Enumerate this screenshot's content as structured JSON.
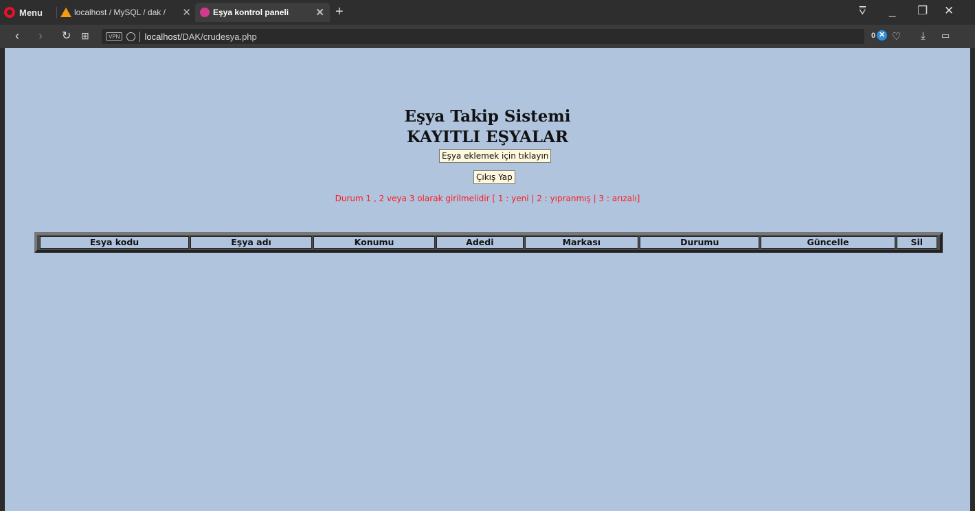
{
  "browser": {
    "menu_label": "Menu",
    "tabs": [
      {
        "title": "localhost / MySQL / dak / ",
        "active": false
      },
      {
        "title": "Eşya kontrol paneli",
        "active": true
      }
    ],
    "new_tab": "+",
    "url_host": "localhost",
    "url_path": "/DAK/crudesya.php",
    "vpn_label": "VPN",
    "adblock_count": "0",
    "icons": [
      "opera-logo",
      "phpmyadmin-favicon",
      "tab-favicon",
      "back-icon",
      "forward-icon",
      "reload-icon",
      "speed-dial-icon",
      "globe-icon",
      "heart-icon",
      "download-icon",
      "battery-icon"
    ]
  },
  "page": {
    "heading": "Eşya Takip Sistemi",
    "subheading": "KAYITLI EŞYALAR",
    "add_button": "Eşya eklemek için tıklayın",
    "logout_button": "Çıkış Yap",
    "status_notice": "Durum 1 , 2 veya 3 olarak girilmelidir [ 1 : yeni | 2 : yıpranmış | 3 : arızalı]",
    "background_color": "#b0c4de",
    "button_color": "#fff8dc",
    "notice_color": "#ff1a1a"
  },
  "table": {
    "columns": [
      "Esya kodu",
      "Eşya adı",
      "Konumu",
      "Adedi",
      "Markası",
      "Durumu",
      "Güncelle",
      "Sil"
    ],
    "rows": []
  }
}
